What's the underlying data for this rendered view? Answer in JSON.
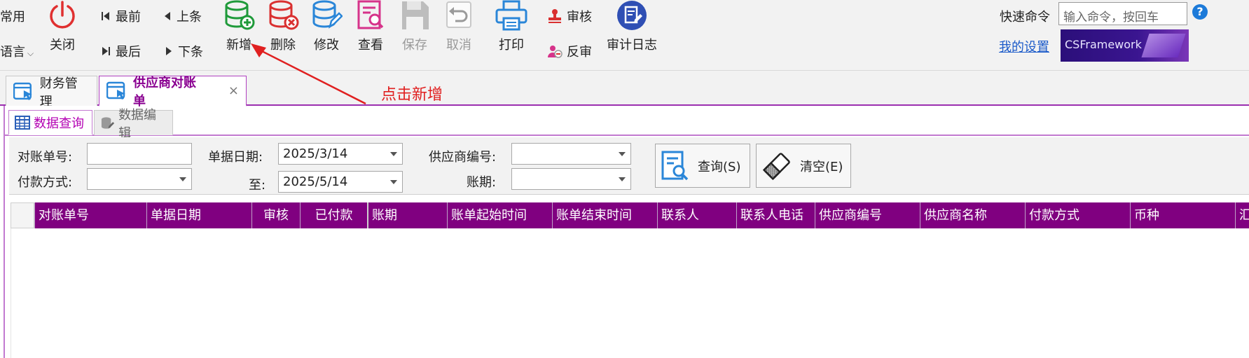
{
  "toolbar": {
    "left_partial_top": "常用",
    "left_partial_bottom": "语言",
    "close": "关闭",
    "nav_first": "最前",
    "nav_prev": "上条",
    "nav_last": "最后",
    "nav_next": "下条",
    "add": "新增",
    "delete": "删除",
    "edit": "修改",
    "view": "查看",
    "save": "保存",
    "cancel": "取消",
    "print": "打印",
    "approve": "审核",
    "unapprove": "反审",
    "audit_log": "审计日志"
  },
  "quick": {
    "label": "快速命令",
    "placeholder": "输入命令，按回车",
    "help": "?",
    "my_settings": "我的设置",
    "brand": "CSFramework"
  },
  "doc_tabs": [
    {
      "label": "财务管理"
    },
    {
      "label": "供应商对账单",
      "close": "×"
    }
  ],
  "sub_tabs": [
    {
      "label": "数据查询"
    },
    {
      "label": "数据编辑"
    }
  ],
  "filter": {
    "bill_no_label": "对账单号:",
    "bill_no_value": "",
    "pay_method_label": "付款方式:",
    "pay_method_value": "",
    "date_label": "单据日期:",
    "date_from": "2025/3/14",
    "to_label": "至:",
    "date_to": "2025/5/14",
    "supplier_code_label": "供应商编号:",
    "supplier_code_value": "",
    "period_label": "账期:",
    "period_value": "",
    "query_button": "查询(S)",
    "clear_button": "清空(E)"
  },
  "grid": {
    "columns": [
      "对账单号",
      "单据日期",
      "审核",
      "已付款",
      "账期",
      "账单起始时间",
      "账单结束时间",
      "联系人",
      "联系人电话",
      "供应商编号",
      "供应商名称",
      "付款方式",
      "币种",
      "汇"
    ],
    "rows": []
  },
  "annotation": {
    "text": "点击新增",
    "color": "#e02020"
  },
  "colors": {
    "grid_header": "#800080",
    "accent": "#b300b3"
  }
}
